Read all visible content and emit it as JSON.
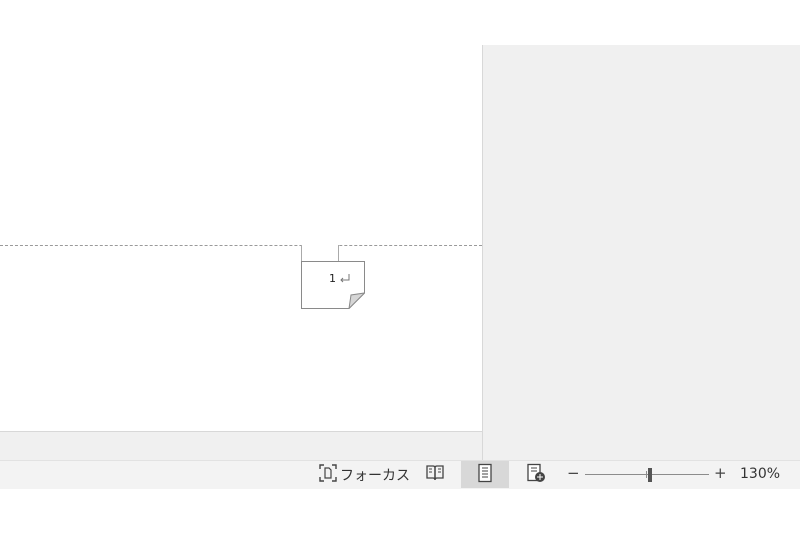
{
  "page_number": {
    "text": "1"
  },
  "status_bar": {
    "focus_label": "フォーカス",
    "zoom_minus": "−",
    "zoom_plus": "+",
    "zoom_level": "130%",
    "zoom_percent": 130
  },
  "icons": {
    "focus": "focus-icon",
    "read_mode": "read-mode-icon",
    "print_layout": "print-layout-icon",
    "web_layout": "web-layout-icon",
    "paragraph_mark": "paragraph-return-icon"
  },
  "colors": {
    "workspace_gray": "#f0f0f0",
    "statusbar_bg": "#f3f3f3",
    "active_view_bg": "#d8d8d8"
  }
}
